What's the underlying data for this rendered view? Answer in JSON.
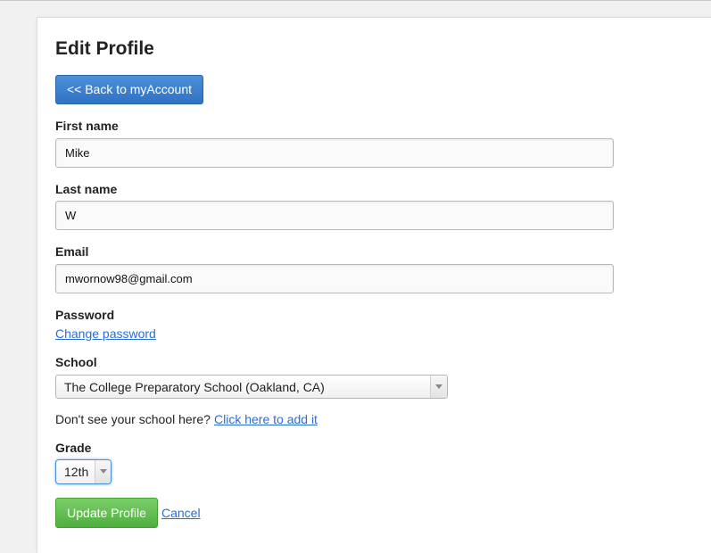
{
  "page": {
    "title": "Edit Profile",
    "back_button": "<< Back to myAccount"
  },
  "form": {
    "first_name": {
      "label": "First name",
      "value": "Mike"
    },
    "last_name": {
      "label": "Last name",
      "value": "W"
    },
    "email": {
      "label": "Email",
      "value": "mwornow98@gmail.com"
    },
    "password": {
      "label": "Password",
      "change_link": "Change password"
    },
    "school": {
      "label": "School",
      "selected": "The College Preparatory School (Oakland, CA)",
      "missing_text": "Don't see your school here?",
      "add_link": "Click here to add it"
    },
    "grade": {
      "label": "Grade",
      "selected": "12th"
    },
    "submit_label": "Update Profile",
    "cancel_label": "Cancel"
  },
  "colors": {
    "primary_button": "#3a7fcf",
    "submit_button": "#5cb84a",
    "link": "#2a6ed4"
  }
}
